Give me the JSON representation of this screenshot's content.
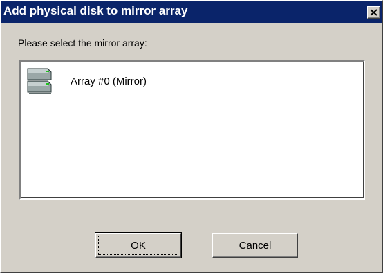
{
  "dialog": {
    "title": "Add physical disk to mirror array",
    "close_label": "×",
    "prompt": "Please select the mirror array:"
  },
  "list": {
    "items": [
      {
        "label": "Array #0 (Mirror)",
        "icon": "disk-array-icon"
      }
    ]
  },
  "buttons": {
    "ok_label": "OK",
    "cancel_label": "Cancel"
  },
  "colors": {
    "titlebar": "#0a246a",
    "face": "#d4d0c8",
    "list_background": "#ffffff"
  }
}
